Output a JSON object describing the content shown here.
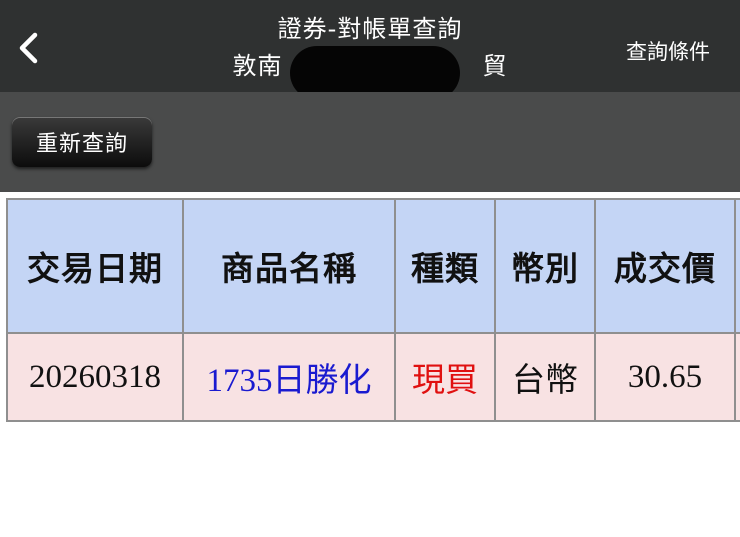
{
  "nav": {
    "title": "證券-對帳單查詢",
    "subtitle_prefix": "敦南",
    "subtitle_suffix": "貿",
    "right_action": "查詢條件",
    "back_icon": "chevron-left-icon"
  },
  "toolbar": {
    "requery_label": "重新查詢"
  },
  "table": {
    "headers": [
      "交易日期",
      "商品名稱",
      "種類",
      "幣別",
      "成交價"
    ],
    "rows": [
      {
        "date": "20260318",
        "product_code": "1735",
        "product_name": "日勝化",
        "type": "現買",
        "currency": "台幣",
        "price": "30.65"
      }
    ]
  },
  "colors": {
    "nav_bg": "#2f3131",
    "toolbar_bg": "#4a4b4b",
    "header_bg": "#c4d5f5",
    "row_bg": "#f8e2e3",
    "product_color": "#1a1ad0",
    "type_color": "#e01010"
  }
}
